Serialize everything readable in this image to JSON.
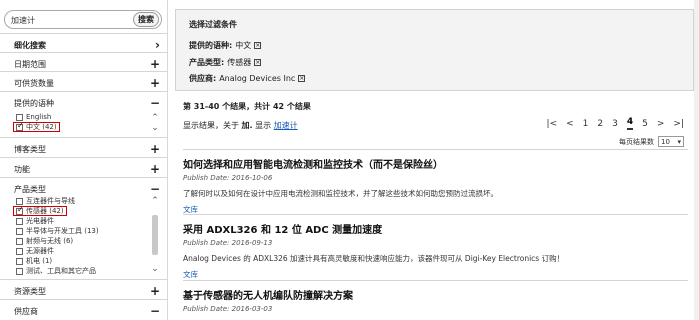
{
  "search": {
    "value": "加速计",
    "button": "搜索"
  },
  "sidebar": {
    "refine": {
      "label": "细化搜索",
      "sign": "›"
    },
    "date_range": {
      "label": "日期范围",
      "sign": "+"
    },
    "available_quantity": {
      "label": "可供货数量",
      "sign": "+"
    },
    "language": {
      "label": "提供的语种",
      "sign": "−",
      "options": [
        {
          "label": "English",
          "checked": false
        },
        {
          "label": "中文 (42)",
          "checked": true
        }
      ]
    },
    "blog_type": {
      "label": "博客类型",
      "sign": "+"
    },
    "function": {
      "label": "功能",
      "sign": "+"
    },
    "product_type": {
      "label": "产品类型",
      "sign": "−",
      "options": [
        {
          "label": "互连器件与导线",
          "checked": false
        },
        {
          "label": "传感器 (42)",
          "checked": true
        },
        {
          "label": "光电器件",
          "checked": false
        },
        {
          "label": "半导体与开发工具 (13)",
          "checked": false
        },
        {
          "label": "射频与无线 (6)",
          "checked": false
        },
        {
          "label": "无源器件",
          "checked": false
        },
        {
          "label": "机电 (1)",
          "checked": false
        },
        {
          "label": "测试、工具和其它产品",
          "checked": false
        }
      ]
    },
    "resource_type": {
      "label": "资源类型",
      "sign": "+"
    },
    "supplier": {
      "label": "供应商",
      "sign": "−"
    }
  },
  "filters": {
    "title": "选择过滤条件",
    "rows": [
      {
        "label": "提供的语种:",
        "value": "中文"
      },
      {
        "label": "产品类型:",
        "value": "传感器"
      },
      {
        "label": "供应商:",
        "value": "Analog Devices Inc"
      }
    ]
  },
  "results": {
    "count_text": "第 31-40 个结果，共计 42 个结果",
    "sub_prefix": "显示结果，关于",
    "sub_term": "加.",
    "sub_middle": "显示",
    "sub_link": "加速计"
  },
  "pager": {
    "first": "|<",
    "prev": "<",
    "pages": [
      "1",
      "2",
      "3",
      "4",
      "5"
    ],
    "current": "4",
    "next": ">",
    "last": ">|",
    "per_page_label": "每页结果数",
    "per_page_value": "10"
  },
  "articles": [
    {
      "title": "如何选择和应用智能电流检测和监控技术（而不是保险丝）",
      "date": "Publish Date: 2016-10-06",
      "desc": "了解何时以及如何在设计中应用电流检测和监控技术，并了解这些技术如何助您预防过流损坏。",
      "tag": "文库"
    },
    {
      "title": "采用 ADXL326 和 12 位 ADC 测量加速度",
      "date": "Publish Date: 2016-09-13",
      "desc": "Analog Devices 的 ADXL326 加速计具有高灵敏度和快速响应能力，该器件现可从 Digi-Key Electronics 订购！",
      "tag": "文库"
    },
    {
      "title": "基于传感器的无人机编队防撞解决方案",
      "date": "Publish Date: 2016-03-03",
      "desc": "",
      "tag": ""
    }
  ],
  "colors": {
    "link": "#1a5bb5",
    "highlight_border": "#d00000",
    "panel_bg": "#f3f3f3"
  }
}
